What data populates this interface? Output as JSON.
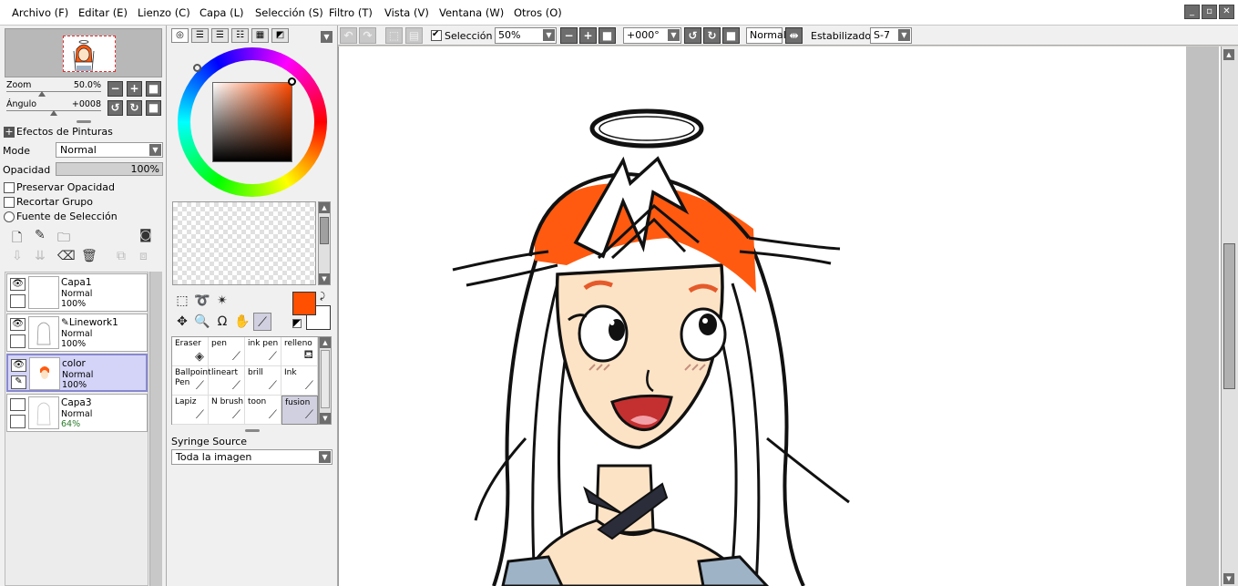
{
  "menu": [
    "Archivo (F)",
    "Editar (E)",
    "Lienzo (C)",
    "Capa (L)",
    "Selección (S)",
    "Filtro (T)",
    "Vista (V)",
    "Ventana (W)",
    "Otros (O)"
  ],
  "navigator": {
    "zoom_label": "Zoom",
    "zoom_value": "50.0%",
    "angle_label": "Ángulo",
    "angle_value": "+0008"
  },
  "layer_props": {
    "effects_label": "Efectos de Pinturas",
    "mode_label": "Mode",
    "mode_value": "Normal",
    "opacity_label": "Opacidad",
    "opacity_value": "100%",
    "preserve_opacity": "Preservar Opacidad",
    "clip_group": "Recortar Grupo",
    "selection_source": "Fuente de Selección"
  },
  "layers": [
    {
      "name": "Capa1",
      "mode": "Normal",
      "opacity": "100%"
    },
    {
      "name": "Linework1",
      "mode": "Normal",
      "opacity": "100%"
    },
    {
      "name": "color",
      "mode": "Normal",
      "opacity": "100%"
    },
    {
      "name": "Capa3",
      "mode": "Normal",
      "opacity": "64%"
    }
  ],
  "brushes": [
    {
      "name": "Eraser",
      "icon": "eraser-icon"
    },
    {
      "name": "pen",
      "icon": "pen-icon"
    },
    {
      "name": "ink pen",
      "icon": "pen-icon"
    },
    {
      "name": "relleno",
      "icon": "bucket-icon"
    },
    {
      "name": "Ballpoint Pen",
      "icon": "pen-icon"
    },
    {
      "name": "lineart",
      "icon": "pen-icon"
    },
    {
      "name": "brill",
      "icon": "pen-icon"
    },
    {
      "name": "Ink",
      "icon": "pen-icon"
    },
    {
      "name": "Lapiz",
      "icon": "pencil-icon"
    },
    {
      "name": "N brush",
      "icon": "brush-icon"
    },
    {
      "name": "toon",
      "icon": "pen-icon"
    },
    {
      "name": "fusion",
      "icon": "brush-icon"
    }
  ],
  "syringe": {
    "label": "Syringe Source",
    "value": "Toda la imagen"
  },
  "toolbar": {
    "selection_label": "Selección",
    "zoom_value": "50%",
    "rotation_value": "+000°",
    "blend_mode": "Normal",
    "stabilizer_label": "Estabilizador",
    "stabilizer_value": "S-7"
  },
  "colors": {
    "foreground": "#ff4f00",
    "background": "#ffffff",
    "selected_layer": "#d4d4f8"
  }
}
